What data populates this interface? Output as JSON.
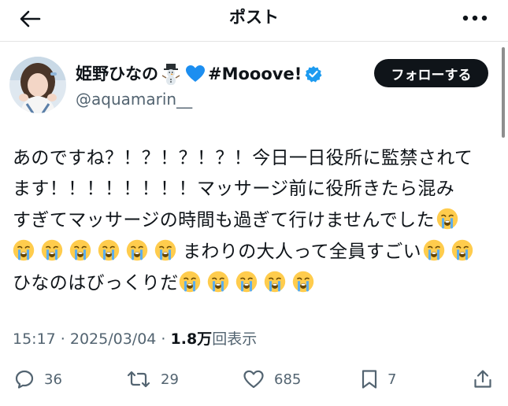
{
  "header": {
    "title": "ポスト"
  },
  "user": {
    "display_name": "姫野ひなの",
    "name_suffix": "#Mooove!",
    "handle": "@aquamarin__",
    "emojis": [
      "snowman-emoji",
      "blue-heart-emoji"
    ],
    "verified": true
  },
  "follow_label": "フォローする",
  "tweet": {
    "lines": [
      "あのですね？！？！？！？！今日一日役所に監禁されて",
      "ます！！！！！！！！マッサージ前に役所きたら混み",
      "すぎてマッサージの時間も過ぎて行けませんでした",
      "まわりの大人って全員すごい",
      "ひなのはびっくりだ"
    ]
  },
  "meta": {
    "time_date": "15:17 · 2025/03/04 · ",
    "views_count": "1.8万",
    "views_label": "回表示"
  },
  "actions": {
    "replies": "36",
    "reposts": "29",
    "likes": "685",
    "bookmarks": "7"
  },
  "colors": {
    "text": "#0f1419",
    "secondary": "#536471",
    "verified": "#1d9bf0",
    "follow_bg": "#0f1419"
  }
}
